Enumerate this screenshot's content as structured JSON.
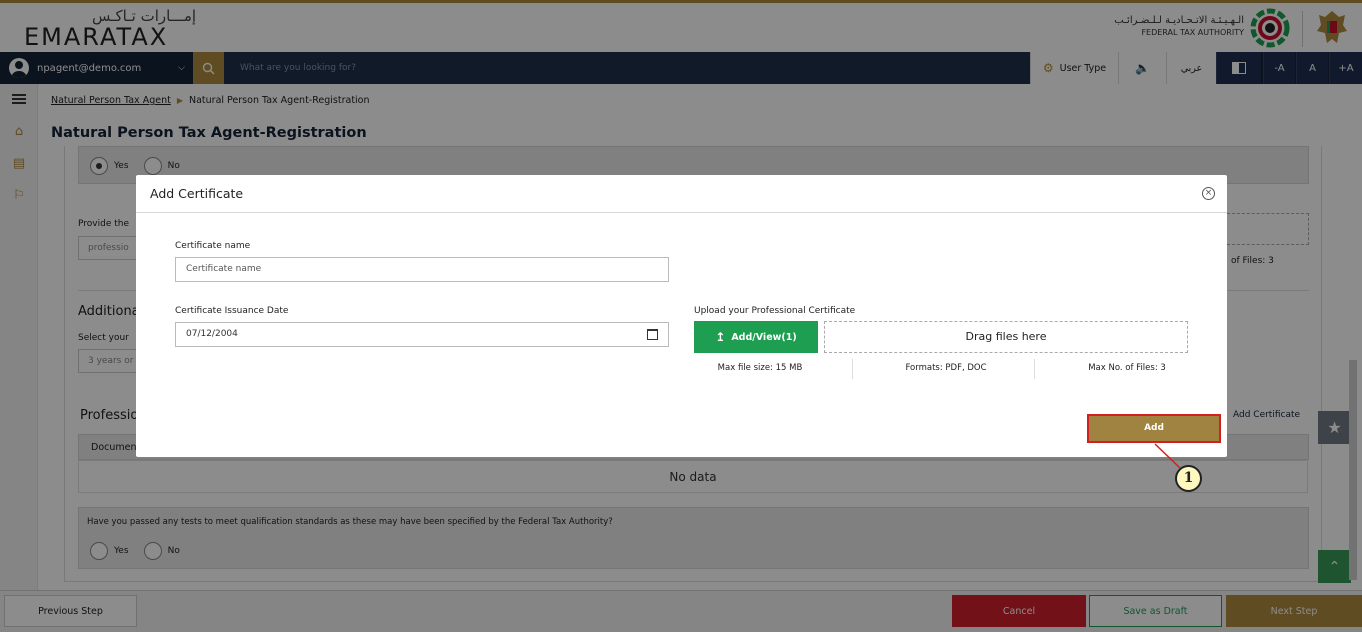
{
  "header": {
    "logo_arabic": "إمـــارات تـاكـس",
    "logo_text": "EMARATAX",
    "authority_arabic": "الـهـيـئـة الاتـحـاديـة لـلـضـرائـب",
    "authority_english": "FEDERAL TAX AUTHORITY"
  },
  "toolbar": {
    "user_email": "npagent@demo.com",
    "search_placeholder": "What are you looking for?",
    "user_type_label": "User Type",
    "arabic_label": "عربي",
    "font_decrease": "-A",
    "font_normal": "A",
    "font_increase": "+A"
  },
  "breadcrumb": {
    "parent": "Natural Person Tax Agent",
    "current": "Natural Person Tax Agent-Registration"
  },
  "page_title": "Natural Person Tax Agent-Registration",
  "background_form": {
    "radio_yes": "Yes",
    "radio_no": "No",
    "provide_label": "Provide the",
    "provide_value": "professio",
    "files_info": "of Files: 3",
    "additional_heading": "Additiona",
    "select_label": "Select your",
    "select_value": "3 years or",
    "professional_heading": "Professio",
    "add_certificate_link": "Add Certificate",
    "table_header": "Documen",
    "no_data": "No data",
    "tests_question": "Have you passed any tests to meet qualification standards as these may have been specified by the Federal Tax Authority?",
    "tests_yes": "Yes",
    "tests_no": "No"
  },
  "modal": {
    "title": "Add Certificate",
    "cert_name_label": "Certificate name",
    "cert_name_placeholder": "Certificate name",
    "issue_date_label": "Certificate Issuance Date",
    "issue_date_value": "07/12/2004",
    "upload_label": "Upload your Professional Certificate",
    "upload_button": "Add/View(1)",
    "drop_text": "Drag files here",
    "max_size": "Max file size: 15 MB",
    "formats": "Formats: PDF, DOC",
    "max_files": "Max No. of Files: 3",
    "add_button": "Add"
  },
  "annotation_marker": "1",
  "footer": {
    "previous": "Previous Step",
    "cancel": "Cancel",
    "save_draft": "Save as Draft",
    "next": "Next Step"
  },
  "colors": {
    "navy": "#15243a",
    "gold": "#b08a3e",
    "green": "#1e9e50",
    "cancel_red": "#d0202a",
    "highlight": "#d31f1f"
  }
}
